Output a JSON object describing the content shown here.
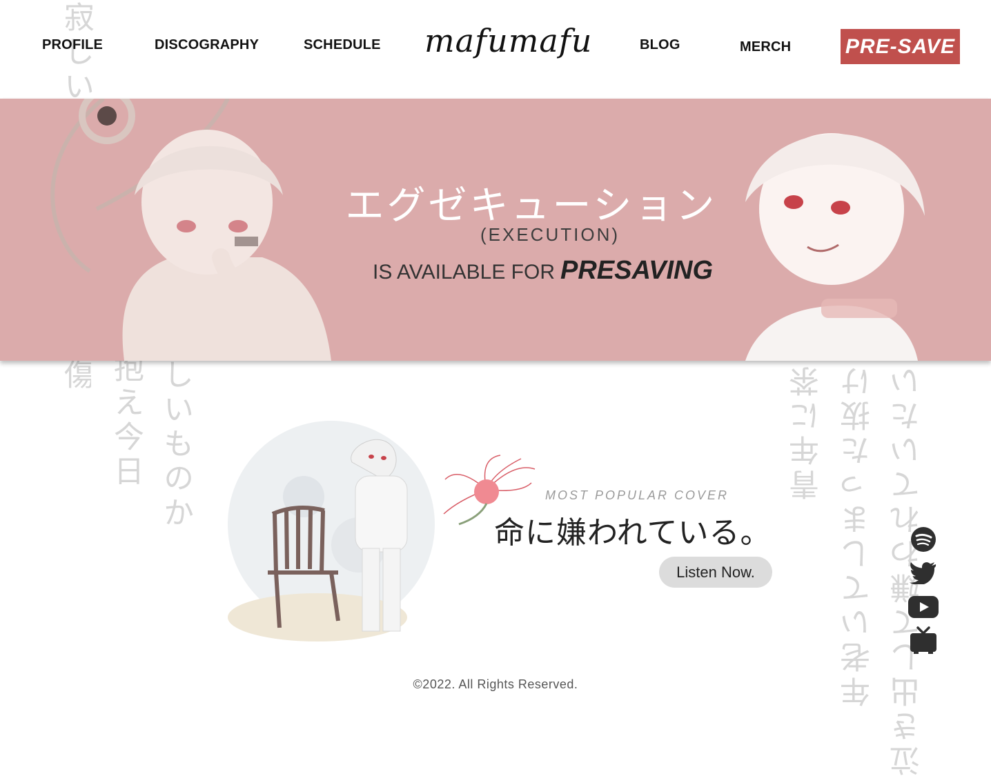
{
  "nav": {
    "left": [
      {
        "label": "PROFILE"
      },
      {
        "label": "DISCOGRAPHY"
      },
      {
        "label": "SCHEDULE"
      }
    ],
    "logo": "mafumafu",
    "right": [
      {
        "label": "BLOG"
      },
      {
        "label": "MERCH"
      }
    ],
    "presave_label": "PRE-SAVE"
  },
  "banner": {
    "title_jp": "エグゼキューション",
    "title_en": "(EXECUTION)",
    "available_text": "IS AVAILABLE FOR",
    "available_emphasis": "PRESAVING"
  },
  "lyrics": {
    "col1": "寂しい",
    "col2": "その傷",
    "col3": "抱え今日",
    "col4": "しいものか",
    "col5": "青年に茶",
    "col6": "年老いてしまった抜け",
    "col7": "泣き出して嫌われていたい"
  },
  "cover": {
    "label": "MOST POPULAR COVER",
    "title": "命に嫌われている。",
    "listen_label": "Listen Now."
  },
  "socials": [
    {
      "name": "spotify-icon"
    },
    {
      "name": "twitter-icon"
    },
    {
      "name": "youtube-icon"
    },
    {
      "name": "niconico-icon"
    }
  ],
  "footer": {
    "copyright": "©2022. All Rights Reserved."
  },
  "colors": {
    "accent": "#c0504d",
    "banner_bg": "#dbabab",
    "button_grey": "#dcdcdc",
    "lyric_grey": "#d6d6d6"
  }
}
